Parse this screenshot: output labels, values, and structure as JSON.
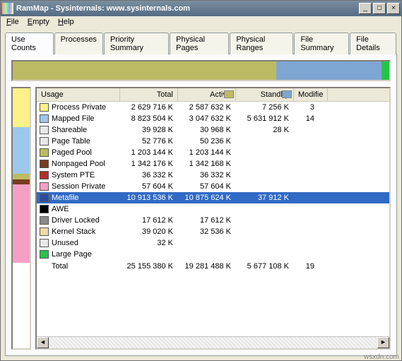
{
  "window": {
    "title": "RamMap - Sysinternals: www.sysinternals.com"
  },
  "menu": {
    "file": "File",
    "empty": "Empty",
    "help": "Help"
  },
  "tabs": [
    "Use Counts",
    "Processes",
    "Priority Summary",
    "Physical Pages",
    "Physical Ranges",
    "File Summary",
    "File Details"
  ],
  "active_tab": 0,
  "summary_bar": [
    {
      "color": "#bcbb63",
      "pct": 70
    },
    {
      "color": "#7ea6d2",
      "pct": 28
    },
    {
      "color": "#27c24c",
      "pct": 2
    }
  ],
  "sidebar_bar": [
    {
      "color": "#fef18a",
      "pct": 15
    },
    {
      "color": "#9dc7eb",
      "pct": 18
    },
    {
      "color": "#bcbb63",
      "pct": 2
    },
    {
      "color": "#7a3c1f",
      "pct": 2
    },
    {
      "color": "#f59fc4",
      "pct": 30
    }
  ],
  "columns": {
    "usage": "Usage",
    "total": "Total",
    "active": "Active",
    "standby": "Standby",
    "modified": "Modifie"
  },
  "col_swatches": {
    "active": "#bcbb63",
    "standby": "#7ea6d2"
  },
  "rows": [
    {
      "sw": "#fef18a",
      "usage": "Process Private",
      "total": "2 629 716 K",
      "active": "2 587 632 K",
      "standby": "7 256 K",
      "modified": "3"
    },
    {
      "sw": "#9dc7eb",
      "usage": "Mapped File",
      "total": "8 823 504 K",
      "active": "3 047 632 K",
      "standby": "5 631 912 K",
      "modified": "14"
    },
    {
      "sw": "#e8e8e8",
      "usage": "Shareable",
      "total": "39 928 K",
      "active": "30 968 K",
      "standby": "28 K",
      "modified": ""
    },
    {
      "sw": "#e8e8e8",
      "usage": "Page Table",
      "total": "52 776 K",
      "active": "50 236 K",
      "standby": "",
      "modified": ""
    },
    {
      "sw": "#bcbb63",
      "usage": "Paged Pool",
      "total": "1 203 144 K",
      "active": "1 203 144 K",
      "standby": "",
      "modified": ""
    },
    {
      "sw": "#7a3c1f",
      "usage": "Nonpaged Pool",
      "total": "1 342 176 K",
      "active": "1 342 168 K",
      "standby": "",
      "modified": ""
    },
    {
      "sw": "#b42d2d",
      "usage": "System PTE",
      "total": "36 332 K",
      "active": "36 332 K",
      "standby": "",
      "modified": ""
    },
    {
      "sw": "#f59fc4",
      "usage": "Session Private",
      "total": "57 604 K",
      "active": "57 604 K",
      "standby": "",
      "modified": ""
    },
    {
      "sw": "#2b4aa0",
      "usage": "Metafile",
      "total": "10 913 536 K",
      "active": "10 875 624 K",
      "standby": "37 912 K",
      "modified": "",
      "selected": true
    },
    {
      "sw": "#000000",
      "usage": "AWE",
      "total": "",
      "active": "",
      "standby": "",
      "modified": ""
    },
    {
      "sw": "#8a8a8a",
      "usage": "Driver Locked",
      "total": "17 612 K",
      "active": "17 612 K",
      "standby": "",
      "modified": ""
    },
    {
      "sw": "#f3d8a8",
      "usage": "Kernel Stack",
      "total": "39 020 K",
      "active": "32 536 K",
      "standby": "",
      "modified": ""
    },
    {
      "sw": "#e8e8e8",
      "usage": "Unused",
      "total": "32 K",
      "active": "",
      "standby": "",
      "modified": ""
    },
    {
      "sw": "#27c24c",
      "usage": "Large Page",
      "total": "",
      "active": "",
      "standby": "",
      "modified": ""
    }
  ],
  "total_row": {
    "usage": "Total",
    "total": "25 155 380 K",
    "active": "19 281 488 K",
    "standby": "5 677 108 K",
    "modified": "19"
  },
  "footer": "wsxdn.com"
}
